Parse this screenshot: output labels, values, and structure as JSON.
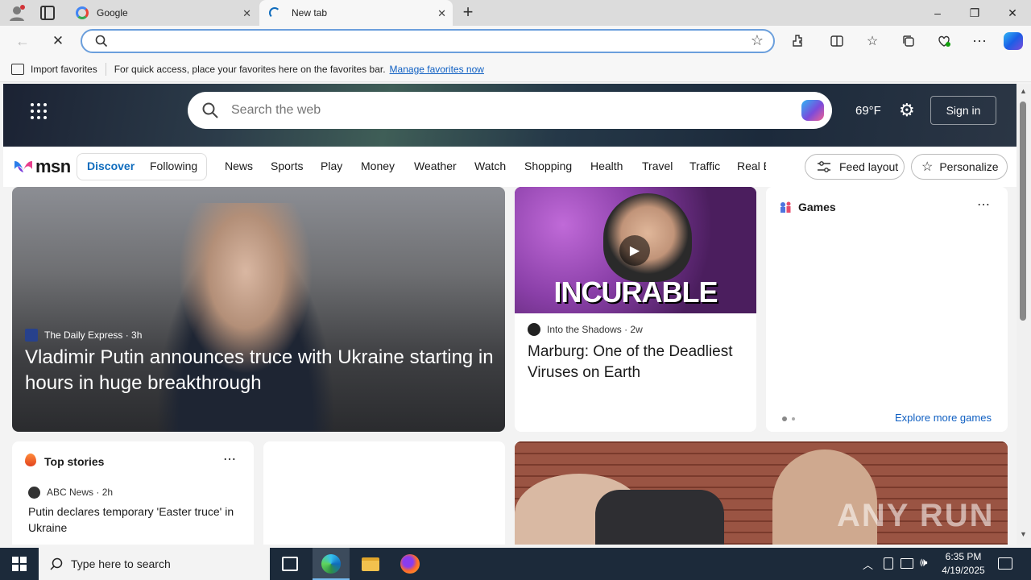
{
  "browser": {
    "tabs": [
      {
        "title": "Google",
        "icon": "google-icon"
      },
      {
        "title": "New tab",
        "icon": "loading-icon"
      }
    ],
    "address_placeholder": "",
    "favorites_bar": {
      "import_label": "Import favorites",
      "hint": "For quick access, place your favorites here on the favorites bar.",
      "manage_link": "Manage favorites now"
    }
  },
  "msn": {
    "search_placeholder": "Search the web",
    "weather": "69°F",
    "sign_in": "Sign in",
    "logo": "msn",
    "feed_tabs": [
      "Discover",
      "Following"
    ],
    "nav": [
      "News",
      "Sports",
      "Play",
      "Money",
      "Weather",
      "Watch",
      "Shopping",
      "Health",
      "Travel",
      "Traffic",
      "Real E"
    ],
    "feed_layout": "Feed layout",
    "personalize": "Personalize",
    "lead_story": {
      "source": "The Daily Express",
      "age": "3h",
      "headline": "Vladimir Putin announces truce with Ukraine starting in hours in huge breakthrough"
    },
    "video_story": {
      "image_text": "INCURABLE",
      "source": "Into the Shadows",
      "age": "2w",
      "headline": "Marburg: One of the Deadliest Viruses on Earth"
    },
    "games": {
      "title": "Games",
      "explore": "Explore more games"
    },
    "top_stories": {
      "title": "Top stories",
      "items": [
        {
          "source": "ABC News",
          "age": "2h",
          "headline": "Putin declares temporary 'Easter truce' in Ukraine"
        }
      ]
    },
    "watermark": "ANY RUN"
  },
  "taskbar": {
    "search_placeholder": "Type here to search",
    "time": "6:35 PM",
    "date": "4/19/2025"
  },
  "colors": {
    "accent": "#0f6cbd",
    "taskbar": "#1c2a3a",
    "link": "#0f5fc2"
  }
}
